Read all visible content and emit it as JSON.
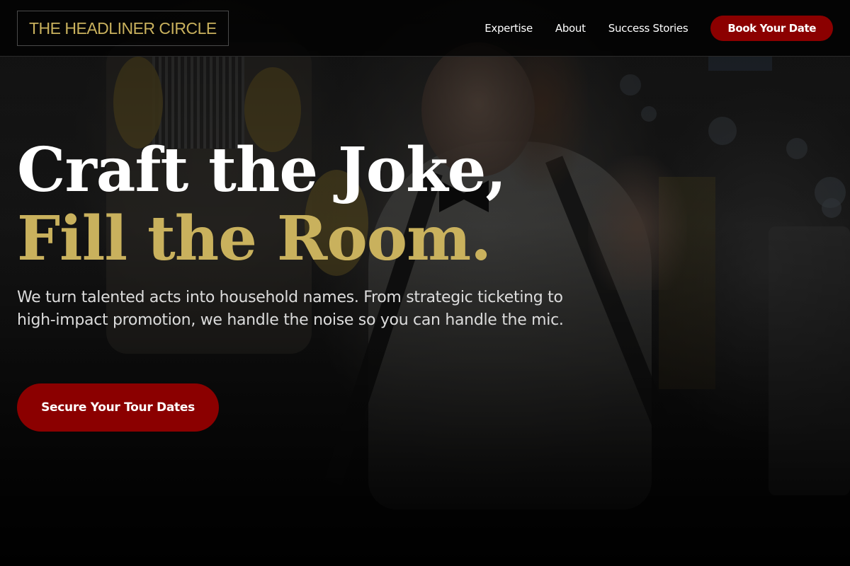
{
  "header": {
    "logo_text": "THE HEADLINER CIRCLE",
    "nav": {
      "items": [
        {
          "label": "Expertise"
        },
        {
          "label": "About"
        },
        {
          "label": "Success Stories"
        }
      ],
      "cta_label": "Book Your Date"
    }
  },
  "hero": {
    "title_line1": "Craft the Joke,",
    "title_line2": "Fill the Room.",
    "description": "We turn talented acts into household names. From strategic ticketing to high-impact promotion, we handle the noise so you can handle the mic.",
    "cta_label": "Secure Your Tour Dates"
  },
  "colors": {
    "accent_gold": "#c9b15d",
    "accent_red": "#8b0000",
    "background": "#070707",
    "text_primary": "#ffffff"
  }
}
